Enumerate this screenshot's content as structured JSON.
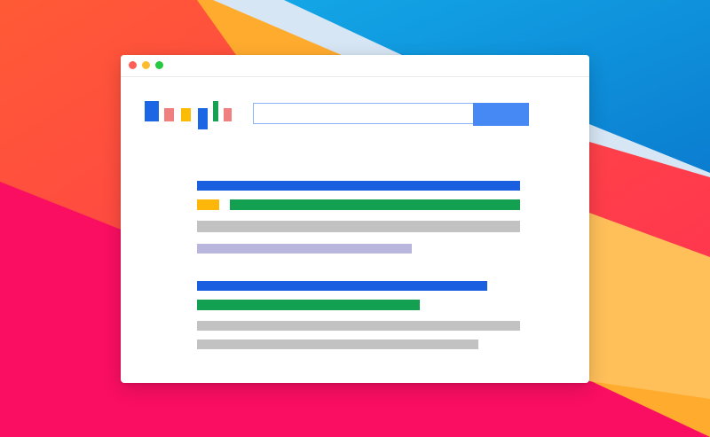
{
  "wallpaper": {
    "colors": {
      "orange_red": "#ff5a36",
      "red_pink": "#ff2e55",
      "magenta": "#fa0e62",
      "sky_blue": "#13a6e6",
      "deep_blue": "#0b7dd0",
      "pale_blue": "#d7e6f4",
      "amber": "#ffab2e",
      "light_amber": "#ffc05a"
    }
  },
  "window": {
    "background": "#ffffff",
    "traffic_lights": {
      "close": "#fe5f57",
      "minimize": "#febb2e",
      "zoom": "#28c840"
    }
  },
  "logo": {
    "icon": "search-engine-logo",
    "bar_colors": [
      "#1a66e5",
      "#f07f7f",
      "#fbbc05",
      "#1a66e5",
      "#18a053",
      "#f07f7f"
    ]
  },
  "search": {
    "value": "",
    "placeholder": "",
    "button_color": "#4689f5",
    "border_color": "#8ab4f8"
  },
  "results": [
    {
      "title_color": "#1a5fe0",
      "badge_color": "#fcb70a",
      "url_color": "#13a050",
      "snippet_colors": [
        "#c2c2c2",
        "#b8b6dc"
      ]
    },
    {
      "title_color": "#1a5fe0",
      "url_color": "#13a050",
      "snippet_colors": [
        "#c2c2c2",
        "#c2c2c2"
      ]
    }
  ]
}
